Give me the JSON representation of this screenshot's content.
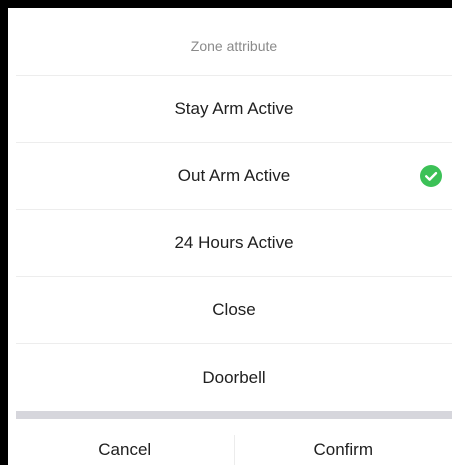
{
  "dialog": {
    "title": "Zone attribute",
    "options": [
      {
        "label": "Stay Arm Active",
        "selected": false
      },
      {
        "label": "Out Arm Active",
        "selected": true
      },
      {
        "label": "24 Hours Active",
        "selected": false
      },
      {
        "label": "Close",
        "selected": false
      },
      {
        "label": "Doorbell",
        "selected": false
      }
    ],
    "selected_icon": "check-circle-icon",
    "cancel_label": "Cancel",
    "confirm_label": "Confirm"
  },
  "colors": {
    "check_green": "#3cc157",
    "separator": "#d6d6dc",
    "frame": "#000000"
  }
}
